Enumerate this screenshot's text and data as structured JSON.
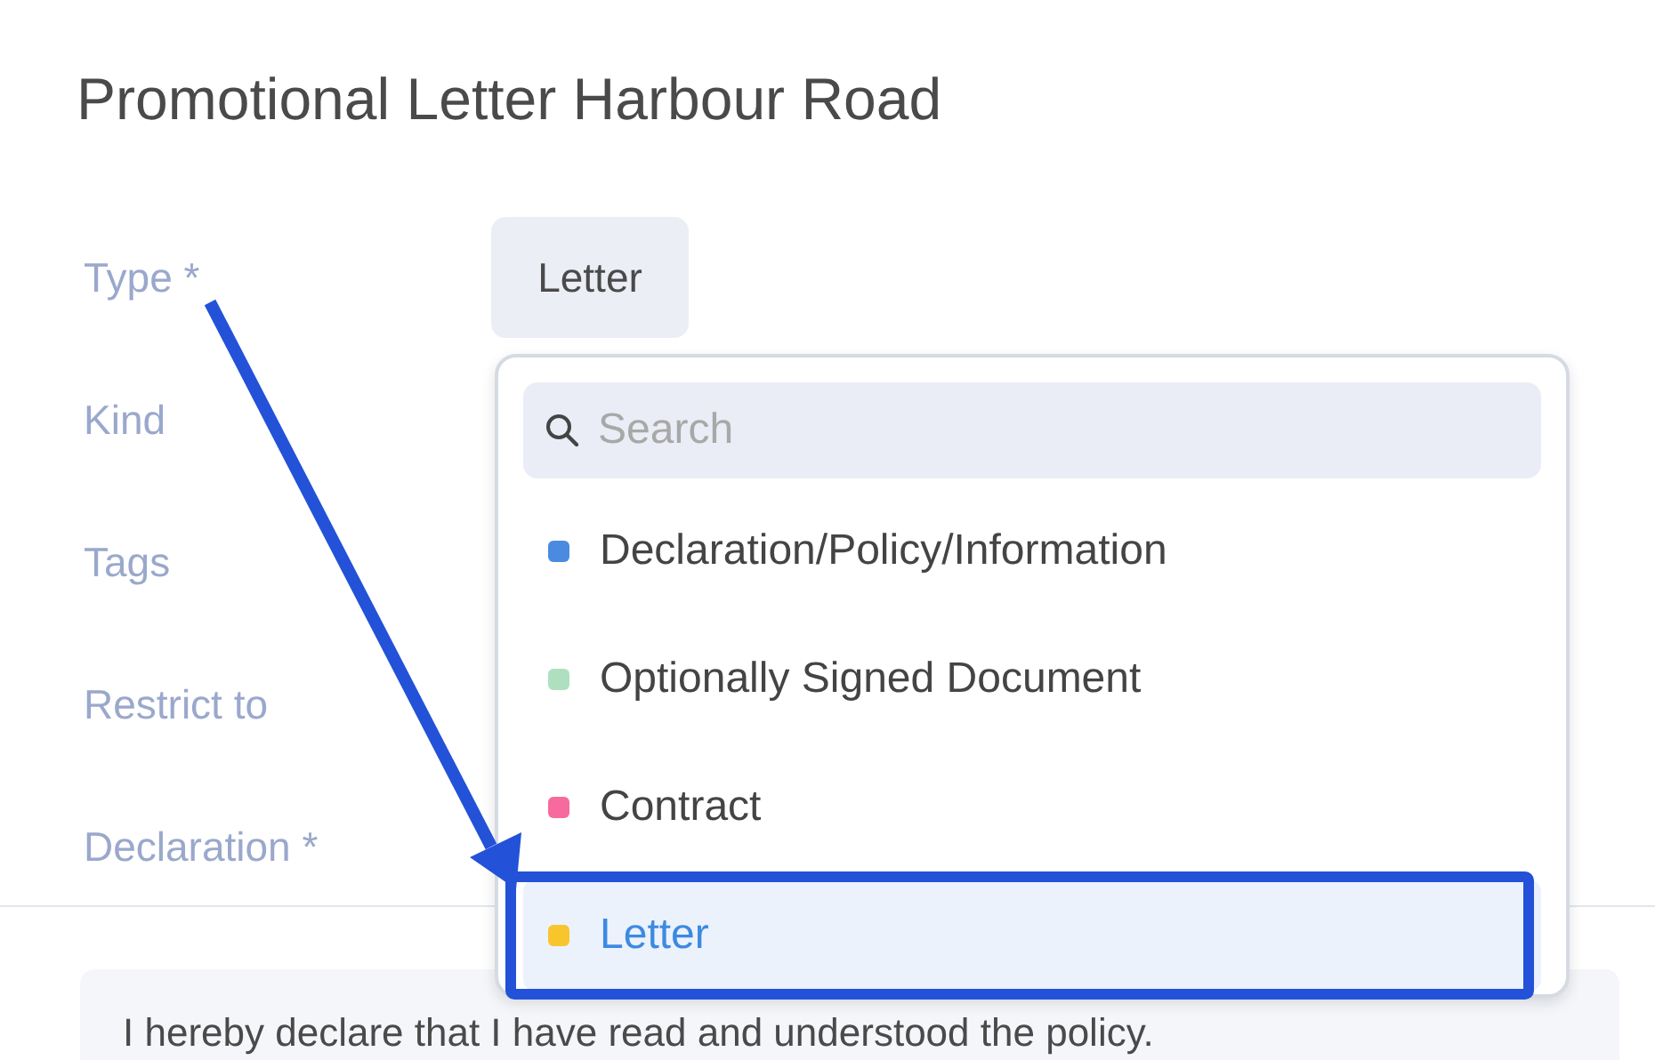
{
  "title": "Promotional Letter Harbour Road",
  "fields": [
    {
      "label": "Type *"
    },
    {
      "label": "Kind"
    },
    {
      "label": "Tags"
    },
    {
      "label": "Restrict to"
    },
    {
      "label": "Declaration *"
    }
  ],
  "type_value": "Letter",
  "dropdown": {
    "search": {
      "placeholder": "Search"
    },
    "options": [
      {
        "label": "Declaration/Policy/Information",
        "color": "#4a8be0",
        "selected": false
      },
      {
        "label": "Optionally Signed Document",
        "color": "#aee0bf",
        "selected": false
      },
      {
        "label": "Contract",
        "color": "#f76a9e",
        "selected": false
      },
      {
        "label": "Letter",
        "color": "#f8c52c",
        "selected": true
      }
    ]
  },
  "declaration_text": "I hereby declare that I have read and understood the policy."
}
